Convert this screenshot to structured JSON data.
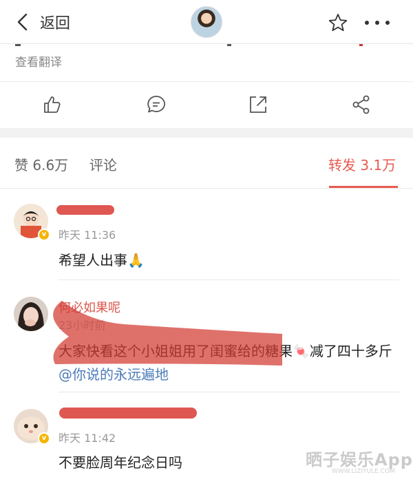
{
  "header": {
    "back_label": "返回"
  },
  "post": {
    "translate_label": "查看翻译"
  },
  "tabs": {
    "likes": "赞 6.6万",
    "comments": "评论",
    "reposts": "转发 3.1万"
  },
  "comments": [
    {
      "name": "",
      "time": "昨天 11:36",
      "text": "希望人出事🙏"
    },
    {
      "name": "何必如果呢",
      "time": "23小时前",
      "text": "大家快看这个小姐姐用了闺蜜给的糖果🍬减了四十多斤",
      "mention": "@你说的永远遍地"
    },
    {
      "name": "",
      "time": "昨天 11:42",
      "text": "不要脸周年纪念日吗"
    }
  ],
  "watermark": {
    "text": "晒子娱乐App",
    "sub": "WWW.LIZIYULE.COM"
  },
  "colors": {
    "accent": "#e85a4f",
    "link": "#4c7bb8",
    "badge": "#f5b400",
    "redaction": "#d93a33"
  }
}
